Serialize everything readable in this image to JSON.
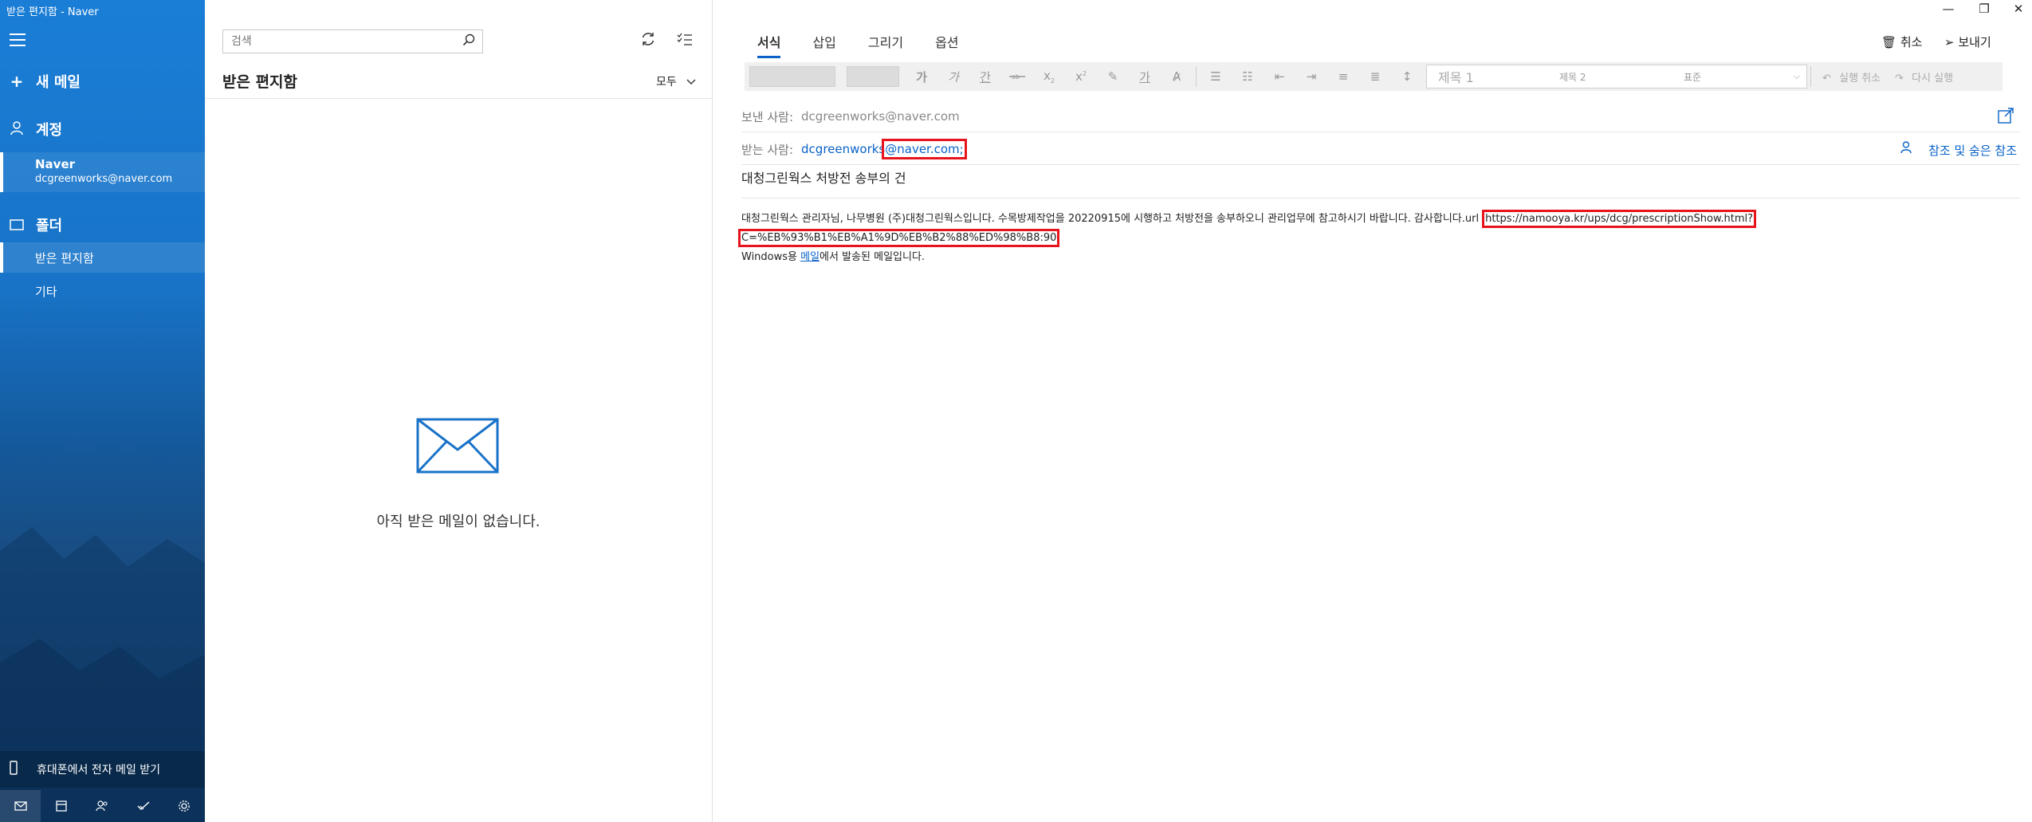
{
  "window_title": "받은 편지함 - Naver",
  "nav": {
    "new_mail": "새 메일",
    "accounts_header": "계정",
    "account": {
      "name": "Naver",
      "email": "dcgreenworks@naver.com"
    },
    "folders_header": "폴더",
    "folders": [
      "받은 편지함",
      "기타"
    ],
    "phone_mail": "휴대폰에서 전자 메일 받기",
    "bottom_icons": [
      "mail-icon",
      "calendar-icon",
      "people-icon",
      "todo-icon",
      "settings-icon"
    ]
  },
  "list": {
    "search_placeholder": "검색",
    "title": "받은 편지함",
    "filter": "모두",
    "empty_message": "아직 받은 메일이 없습니다."
  },
  "compose": {
    "tabs": [
      "서식",
      "삽입",
      "그리기",
      "옵션"
    ],
    "discard_label": "취소",
    "send_label": "보내기",
    "toolbar": {
      "bold": "가",
      "italic": "가",
      "underline": "간",
      "strike": "ㅡ",
      "sub": "x",
      "sup": "x",
      "highlight": "가",
      "style_1": "제목 1",
      "style_2": "제목 2",
      "style_3": "표준",
      "undo": "실행 취소",
      "redo": "다시 실행"
    },
    "from_label": "보낸 사람:",
    "from_value": "dcgreenworks@naver.com",
    "to_label": "받는 사람:",
    "to_value_pre": "dcgreenworks",
    "to_value_boxed": "@naver.com;",
    "cc_label": "참조 및 숨은 참조",
    "subject": "대청그린웍스 처방전 송부의 건",
    "body_text": "대청그린웍스 관리자님, 나무병원 (주)대청그린웍스입니다. 수목방제작업을 20220915에 시행하고 처방전을 송부하오니 관리업무에 참고하시기 바랍니다. 감사합니다.url",
    "body_url": "https://namooya.kr/ups/dcg/prescriptionShow.html?C=%EB%93%B1%EB%A1%9D%EB%B2%88%ED%98%B8:90",
    "signature_pre": "Windows용 ",
    "signature_link": "메일",
    "signature_post": "에서 발송된 메일입니다.",
    "accent_color": "#0a62c8",
    "highlight_box_color": "#e8141d"
  }
}
